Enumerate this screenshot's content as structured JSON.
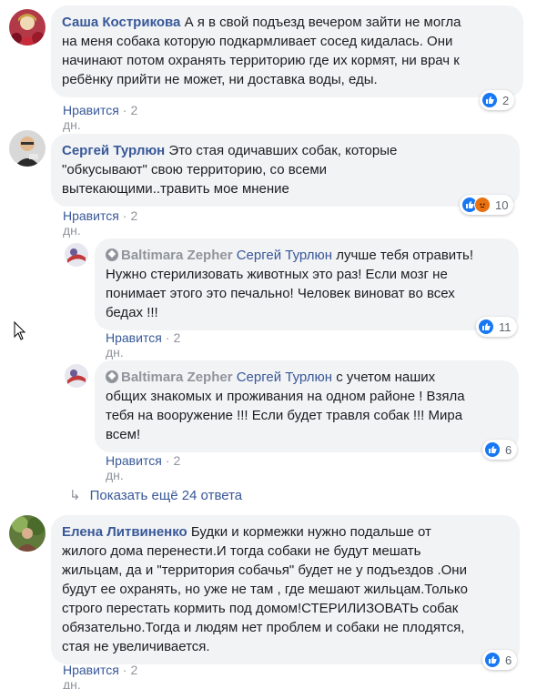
{
  "comments": [
    {
      "author": "Саша Кострикова",
      "text_lines": [
        "А я в свой подъезд вечером зайти не могла",
        "на меня собака которую подкармливает сосед кидалась. Они",
        "начинают потом охранять территорию где их кормят, ни врач к",
        "ребёнку прийти не может, ни доставка воды, еды."
      ],
      "like_label": "Нравится",
      "time": "2 дн.",
      "reaction_count": "2"
    },
    {
      "author": "Сергей Турлюн",
      "text_lines": [
        "Это стая одичавших собак, которые",
        "\"обкусывают\" свою территорию, со всеми",
        "вытекающими..травить мое мнение"
      ],
      "like_label": "Нравится",
      "time": "2 дн.",
      "reaction_count": "10"
    },
    {
      "author": "Baltimara Zepher",
      "mention": "Сергей Турлюн",
      "text_lines": [
        "лучше тебя отравить!",
        "Нужно стерилизовать животных это раз! Если мозг не",
        "понимает этого это печально! Человек виноват во всех",
        "бедах !!!"
      ],
      "like_label": "Нравится",
      "time": "2 дн.",
      "reaction_count": "11"
    },
    {
      "author": "Baltimara Zepher",
      "mention": "Сергей Турлюн",
      "text_lines": [
        "с учетом наших",
        "общих знакомых и проживания на одном районе ! Взяла",
        "тебя на вооружение !!! Если будет травля собак !!! Мира",
        "всем!"
      ],
      "like_label": "Нравится",
      "time": "2 дн.",
      "reaction_count": "6"
    },
    {
      "author": "Елена Литвиненко",
      "text_lines": [
        "Будки и кормежки нужно подальше от",
        "жилого дома перенести.И тогда собаки не будут мешать",
        "жильцам, да и \"территория собачья\" будет не у подъездов .Они",
        "будут ее охранять, но уже не там , где мешают жильцам.Только",
        "строго перестать кормить под домом!СТЕРИЛИЗОВАТЬ собак",
        "обязательно.Тогда и людям нет проблем и собаки не плодятся,",
        "стая не увеличивается."
      ],
      "like_label": "Нравится",
      "time": "2 дн.",
      "reaction_count": "6"
    }
  ],
  "show_more": {
    "arrow": "↳",
    "label": "Показать ещё 24 ответа"
  },
  "colors": {
    "link": "#385898",
    "meta": "#90949c",
    "bubble": "#f2f3f5",
    "like": "#1877f2",
    "angry": "#e9710f"
  },
  "icons": [
    "like-reaction-icon",
    "angry-reaction-icon",
    "verified-badge-icon",
    "reply-arrow-icon",
    "mouse-cursor-icon"
  ]
}
